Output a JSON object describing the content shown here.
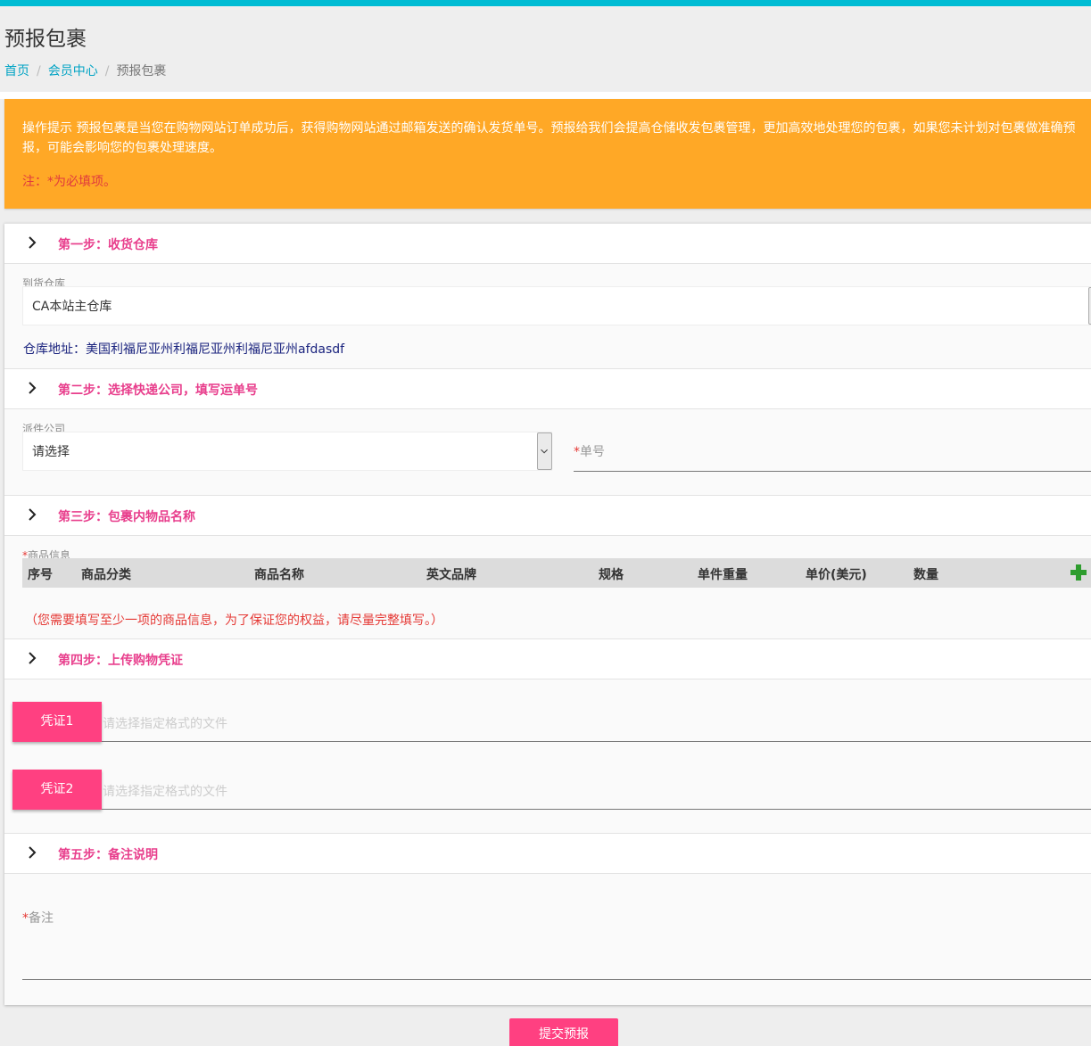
{
  "header": {
    "title": "预报包裹",
    "breadcrumb": [
      "首页",
      "会员中心",
      "预报包裹"
    ]
  },
  "alert": {
    "text": "操作提示 预报包裹是当您在购物网站订单成功后，获得购物网站通过邮箱发送的确认发货单号。预报给我们会提高仓储收发包裹管理，更加高效地处理您的包裹，如果您未计划对包裹做准确预报，可能会影响您的包裹处理速度。",
    "note": "注：*为必填项。"
  },
  "step1": {
    "title": "第一步：收货仓库",
    "warehouse_label": "到货仓库",
    "warehouse_value": "CA本站主仓库",
    "address": "仓库地址：美国利福尼亚州利福尼亚州利福尼亚州afdasdf"
  },
  "step2": {
    "title": "第二步：选择快递公司，填写运单号",
    "carrier_label": "派件公司",
    "carrier_value": "请选择",
    "tracking_star": "*",
    "tracking_label": "单号"
  },
  "step3": {
    "title": "第三步：包裹内物品名称",
    "goods_star": "*",
    "goods_label": "商品信息",
    "columns": [
      "序号",
      "商品分类",
      "商品名称",
      "英文品牌",
      "规格",
      "单件重量",
      "单价(美元)",
      "数量"
    ],
    "warning": "（您需要填写至少一项的商品信息，为了保证您的权益，请尽量完整填写。）"
  },
  "step4": {
    "title": "第四步：上传购物凭证",
    "voucher1": "凭证1",
    "voucher2": "凭证2",
    "file_placeholder": "请选择指定格式的文件"
  },
  "step5": {
    "title": "第五步：备注说明",
    "remark_star": "*",
    "remark_label": "备注"
  },
  "submit_label": "提交预报",
  "colors": {
    "accent": "#00bcd4",
    "pink": "#ff4081",
    "alert": "#ffa826",
    "step_title": "#e83e8c"
  }
}
